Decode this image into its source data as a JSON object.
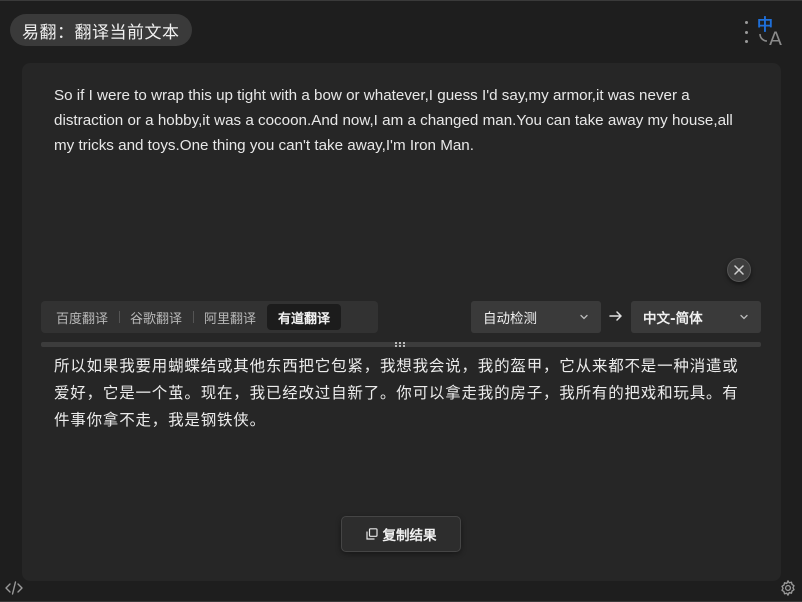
{
  "header": {
    "title": "易翻：翻译当前文本",
    "menu_icon": "more-vertical-icon",
    "logo_icon": "translate-logo-icon",
    "logo_text_cn": "中",
    "logo_text_en": "A"
  },
  "source": {
    "text": "So if I were to wrap this up tight with a bow or whatever,I guess I'd say,my armor,it was never a distraction or a hobby,it was a cocoon.And now,I am a changed man.You can take away my house,all my tricks and toys.One thing you can't take away,I'm Iron Man."
  },
  "engines": {
    "tabs": [
      {
        "label": "百度翻译",
        "active": false
      },
      {
        "label": "谷歌翻译",
        "active": false
      },
      {
        "label": "阿里翻译",
        "active": false
      },
      {
        "label": "有道翻译",
        "active": true
      }
    ]
  },
  "languages": {
    "from": "自动检测",
    "to": "中文-简体"
  },
  "result": {
    "text": "所以如果我要用蝴蝶结或其他东西把它包紧，我想我会说，我的盔甲，它从来都不是一种消遣或爱好，它是一个茧。现在，我已经改过自新了。你可以拿走我的房子，我所有的把戏和玩具。有件事你拿不走，我是钢铁侠。",
    "copy_label": "复制结果"
  },
  "colors": {
    "accent": "#1e6fd9",
    "background": "#1e1e1e",
    "panel": "#262626"
  }
}
